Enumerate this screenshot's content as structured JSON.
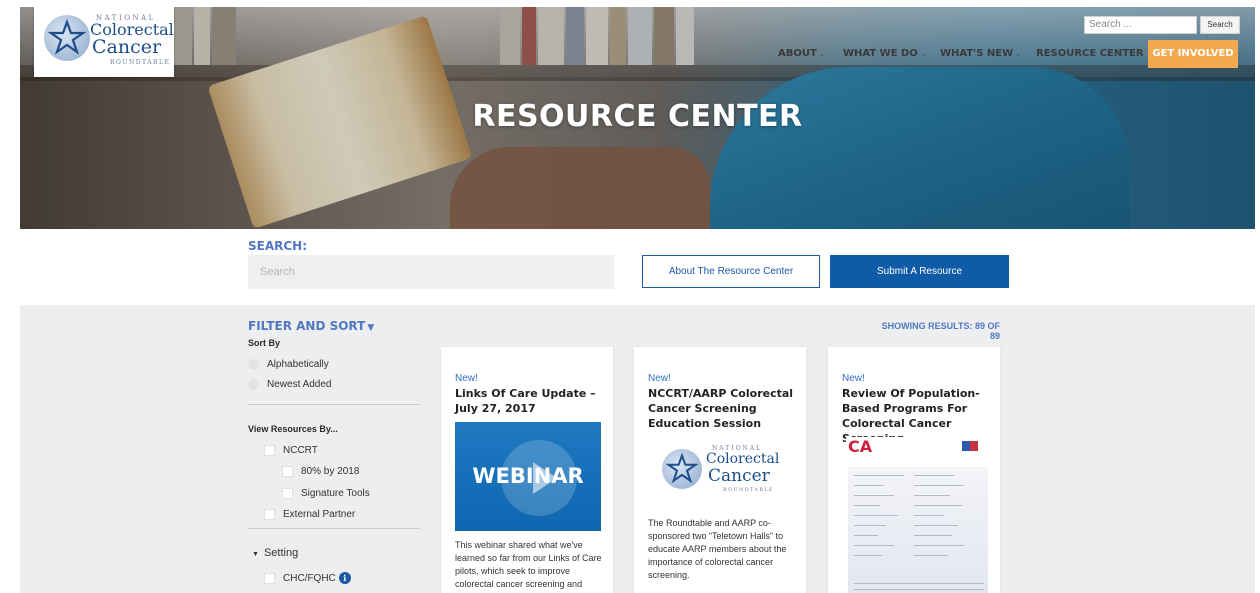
{
  "logo": {
    "national": "NATIONAL",
    "line1": "Colorectal",
    "line2": "Cancer",
    "roundtable": "ROUNDTABLE"
  },
  "header": {
    "search_placeholder": "Search ...",
    "search_button": "Search",
    "nav": [
      {
        "label": "ABOUT",
        "has_dropdown": true
      },
      {
        "label": "WHAT WE DO",
        "has_dropdown": true
      },
      {
        "label": "WHAT'S NEW",
        "has_dropdown": true
      },
      {
        "label": "RESOURCE CENTER",
        "has_dropdown": false
      }
    ],
    "cta": "GET INVOLVED",
    "cta_color": "#f5a94e"
  },
  "hero": {
    "title": "RESOURCE CENTER"
  },
  "search": {
    "label": "SEARCH:",
    "placeholder": "Search",
    "about_button": "About The Resource Center",
    "submit_button": "Submit A Resource"
  },
  "filter": {
    "title": "FILTER AND SORT",
    "results": "SHOWING RESULTS: 89 OF 89",
    "sort_by_label": "Sort By",
    "sort_options": [
      "Alphabetically",
      "Newest Added"
    ],
    "view_by_label": "View Resources By...",
    "view_options": [
      "NCCRT",
      "80% by 2018",
      "Signature Tools",
      "External Partner"
    ],
    "setting_label": "Setting",
    "setting_options": [
      "CHC/FQHC"
    ],
    "info_glyph": "i"
  },
  "cards": [
    {
      "badge": "New!",
      "title": "Links Of Care Update – July 27, 2017",
      "image_text": "WEBINAR",
      "description": "This webinar shared what we've learned so far from our Links of Care pilots, which seek to improve colorectal cancer screening and"
    },
    {
      "badge": "New!",
      "title": "NCCRT/AARP Colorectal Cancer Screening Education Session",
      "description": "The Roundtable and AARP co-sponsored two “Teletown Halls” to educate AARP members about the importance of colorectal cancer screening."
    },
    {
      "badge": "New!",
      "title": "Review Of Population-Based Programs For Colorectal Cancer Screening",
      "image_text": "CA"
    }
  ],
  "colors": {
    "brand_blue": "#1d59a6",
    "accent_blue": "#5277c2",
    "background_gray": "#eceeef"
  }
}
